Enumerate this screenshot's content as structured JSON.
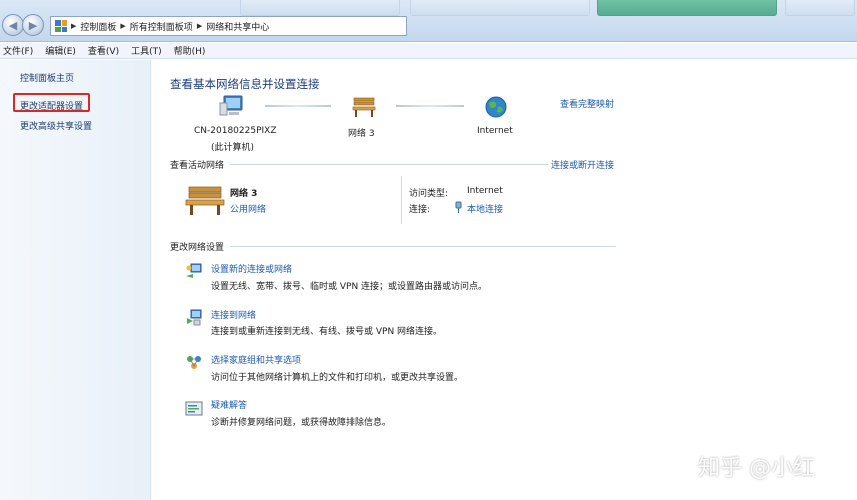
{
  "address_bar": {
    "crumbs": [
      "控制面板",
      "所有控制面板项",
      "网络和共享中心"
    ]
  },
  "menu": [
    "文件(F)",
    "编辑(E)",
    "查看(V)",
    "工具(T)",
    "帮助(H)"
  ],
  "sidebar": {
    "items": [
      {
        "label": "控制面板主页"
      },
      {
        "label": "更改适配器设置"
      },
      {
        "label": "更改高级共享设置"
      }
    ]
  },
  "main": {
    "title": "查看基本网络信息并设置连接",
    "view_full_map": "查看完整映射",
    "map": {
      "computer_name": "CN-20180225PIXZ",
      "computer_sub": "(此计算机)",
      "network_name": "网络  3",
      "internet": "Internet"
    },
    "active_networks": {
      "title": "查看活动网络",
      "connect_disconnect": "连接或断开连接",
      "network_name": "网络  3",
      "network_type": "公用网络",
      "access_type_label": "访问类型:",
      "access_type_value": "Internet",
      "connection_label": "连接:",
      "connection_value": "本地连接"
    },
    "change_settings": {
      "title": "更改网络设置",
      "items": [
        {
          "icon": "network-setup-icon",
          "label": "设置新的连接或网络",
          "desc": "设置无线、宽带、拨号、临时或 VPN 连接；或设置路由器或访问点。"
        },
        {
          "icon": "connect-network-icon",
          "label": "连接到网络",
          "desc": "连接到或重新连接到无线、有线、拨号或 VPN 网络连接。"
        },
        {
          "icon": "homegroup-icon",
          "label": "选择家庭组和共享选项",
          "desc": "访问位于其他网络计算机上的文件和打印机，或更改共享设置。"
        },
        {
          "icon": "troubleshoot-icon",
          "label": "疑难解答",
          "desc": "诊断并修复网络问题，或获得故障排除信息。"
        }
      ]
    }
  },
  "watermark": "知乎 @小红",
  "colors": {
    "link": "#1c5bb0",
    "highlight": "#d52a26",
    "heading": "#1e3d7a"
  }
}
